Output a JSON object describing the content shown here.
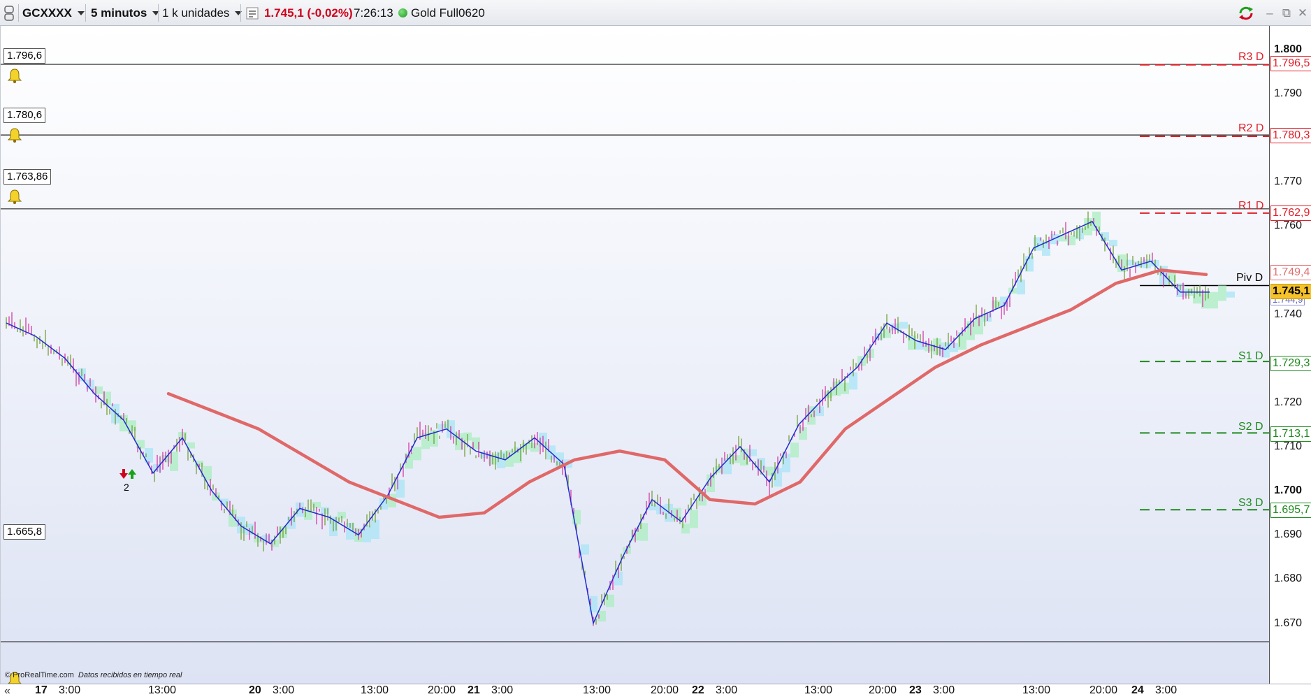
{
  "toolbar": {
    "instrument": "GCXXXX",
    "timeframe": "5 minutos",
    "units": "1 k unidades",
    "price_change": "1.745,1 (-0,02%)",
    "time": "7:26:13",
    "contract": "Gold Full0620"
  },
  "alerts": [
    {
      "label": "1.796,6",
      "price": 1796.6
    },
    {
      "label": "1.780,6",
      "price": 1780.6
    },
    {
      "label": "1.763,86",
      "price": 1763.86
    },
    {
      "label": "1.665,8",
      "price": 1665.8
    }
  ],
  "pivots": [
    {
      "name": "R3 D",
      "tag": "1.796,5",
      "price": 1796.5,
      "color": "#e0202a"
    },
    {
      "name": "R2 D",
      "tag": "1.780,3",
      "price": 1780.3,
      "color": "#e0202a"
    },
    {
      "name": "R1 D",
      "tag": "1.762,9",
      "price": 1762.9,
      "color": "#e0202a"
    },
    {
      "name": "Piv D",
      "tag": "",
      "price": 1746.5,
      "color": "#000000"
    },
    {
      "name": "S1 D",
      "tag": "1.729,3",
      "price": 1729.3,
      "color": "#1e8a1e"
    },
    {
      "name": "S2 D",
      "tag": "1.713,1",
      "price": 1713.1,
      "color": "#1e8a1e"
    },
    {
      "name": "S3 D",
      "tag": "1.695,7",
      "price": 1695.7,
      "color": "#1e8a1e"
    }
  ],
  "price_tags": {
    "ma_value": "1.749,4",
    "last": "1.745,1",
    "lower": "1.744,9"
  },
  "y_axis": {
    "ticks": [
      {
        "label": "1.800",
        "v": 1800,
        "bold": true
      },
      {
        "label": "1.790",
        "v": 1790
      },
      {
        "label": "1.770",
        "v": 1770
      },
      {
        "label": "1.760",
        "v": 1760
      },
      {
        "label": "1.740",
        "v": 1740
      },
      {
        "label": "1.720",
        "v": 1720
      },
      {
        "label": "1.710",
        "v": 1710
      },
      {
        "label": "1.700",
        "v": 1700,
        "bold": true
      },
      {
        "label": "1.690",
        "v": 1690
      },
      {
        "label": "1.680",
        "v": 1680
      },
      {
        "label": "1.670",
        "v": 1670
      }
    ]
  },
  "x_axis": {
    "ticks": [
      {
        "label": "17",
        "bold": true
      },
      {
        "label": "3:00"
      },
      {
        "label": "13:00"
      },
      {
        "label": "20",
        "bold": true
      },
      {
        "label": "3:00"
      },
      {
        "label": "13:00"
      },
      {
        "label": "20:00"
      },
      {
        "label": "21",
        "bold": true
      },
      {
        "label": "3:00"
      },
      {
        "label": "13:00"
      },
      {
        "label": "20:00"
      },
      {
        "label": "22",
        "bold": true
      },
      {
        "label": "3:00"
      },
      {
        "label": "13:00"
      },
      {
        "label": "20:00"
      },
      {
        "label": "23",
        "bold": true
      },
      {
        "label": "3:00"
      },
      {
        "label": "13:00"
      },
      {
        "label": "20:00"
      },
      {
        "label": "24",
        "bold": true
      },
      {
        "label": "3:00"
      }
    ]
  },
  "signal": {
    "count": "2"
  },
  "footer": {
    "site": "© ProRealTime.com",
    "note": "Datos recibidos en tiempo real"
  },
  "chart_data": {
    "type": "line",
    "series": [
      {
        "values": [
          1738,
          1735,
          1730,
          1722,
          1716,
          1704,
          1712,
          1700,
          1692,
          1688,
          1696,
          1694,
          1690,
          1699,
          1712,
          1714,
          1709,
          1707,
          1712,
          1706,
          1670,
          1685,
          1698,
          1693,
          1703,
          1710,
          1702,
          1715,
          1722,
          1728,
          1738,
          1734,
          1732,
          1739,
          1742,
          1755,
          1758,
          1761,
          1750,
          1752,
          1745,
          1745
        ]
      },
      {
        "values": [
          1722,
          1718,
          1714,
          1708,
          1702,
          1698,
          1694,
          1695,
          1702,
          1707,
          1709,
          1707,
          1698,
          1697,
          1702,
          1714,
          1721,
          1728,
          1733,
          1737,
          1741,
          1747,
          1750,
          1749
        ]
      }
    ]
  }
}
